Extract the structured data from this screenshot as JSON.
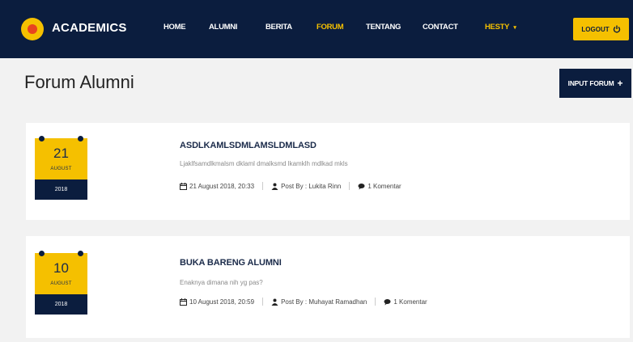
{
  "header": {
    "brand": "ACADEMICS",
    "nav": [
      {
        "label": "HOME",
        "active": false
      },
      {
        "label": "ALUMNI",
        "active": false
      },
      {
        "label": "BERITA",
        "active": false
      },
      {
        "label": "FORUM",
        "active": true
      },
      {
        "label": "TENTANG",
        "active": false
      },
      {
        "label": "CONTACT",
        "active": false
      }
    ],
    "user_menu": "HESTY",
    "logout_label": "LOGOUT"
  },
  "page": {
    "title": "Forum Alumni",
    "input_button_label": "INPUT FORUM"
  },
  "posts": [
    {
      "day": "21",
      "month": "AUGUST",
      "year": "2018",
      "title": "ASDLKAMLSDMLAMSLDMLASD",
      "excerpt": "Ljaklfsamdlkmalsm dklaml dmalksmd lkamklh mdlkad mkls",
      "datetime": "21 August 2018, 20:33",
      "author": "Post By : Lukita Rinn",
      "comments": "1 Komentar"
    },
    {
      "day": "10",
      "month": "AUGUST",
      "year": "2018",
      "title": "BUKA BARENG ALUMNI",
      "excerpt": "Enaknya dimana nih yg pas?",
      "datetime": "10 August 2018, 20:59",
      "author": "Post By : Muhayat Ramadhan",
      "comments": "1 Komentar"
    }
  ],
  "colors": {
    "navy": "#0b1d3e",
    "accent": "#f5c000",
    "background": "#f2f2f2"
  }
}
